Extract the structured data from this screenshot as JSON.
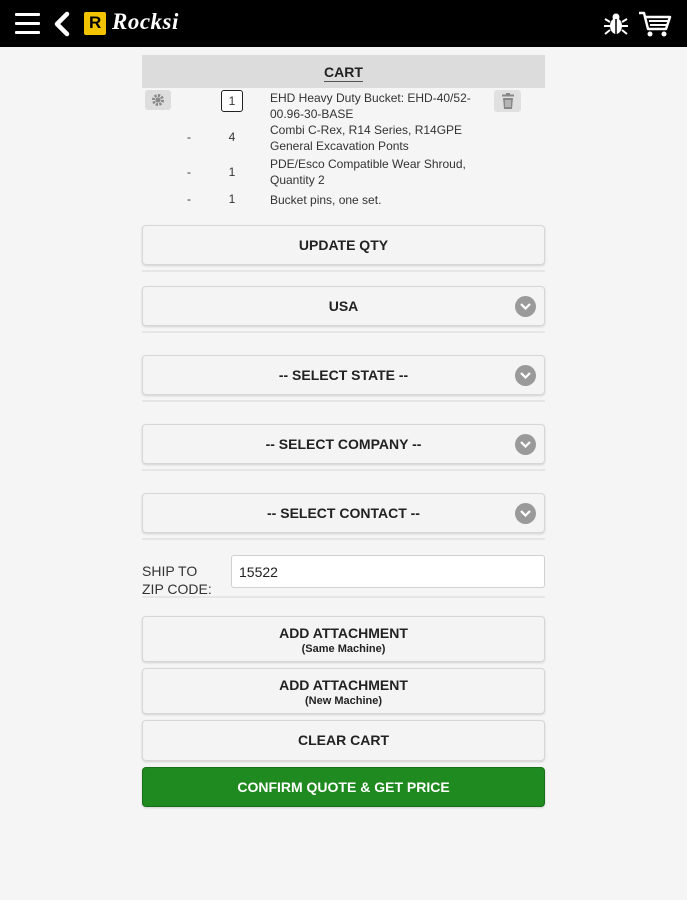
{
  "app": {
    "logo_letter": "R",
    "logo_text": "Rocksi",
    "brand_color": "#f2c300"
  },
  "cart": {
    "title": "CART",
    "items": [
      {
        "qty": "1",
        "desc": "EHD Heavy Duty Bucket: EHD-40/52-00.96-30-BASE"
      },
      {
        "dash": "-",
        "qty": "4",
        "desc": "Combi C-Rex, R14 Series, R14GPE General Excavation Ponts"
      },
      {
        "dash": "-",
        "qty": "1",
        "desc": "PDE/Esco Compatible Wear Shroud, Quantity 2"
      },
      {
        "dash": "-",
        "qty": "1",
        "desc": "Bucket pins, one set."
      }
    ]
  },
  "buttons": {
    "update_qty": "UPDATE QTY",
    "add_attachment_same": "ADD ATTACHMENT",
    "add_attachment_same_sub": "(Same Machine)",
    "add_attachment_new": "ADD ATTACHMENT",
    "add_attachment_new_sub": "(New Machine)",
    "clear_cart": "CLEAR CART",
    "confirm": "CONFIRM QUOTE & GET PRICE"
  },
  "selects": {
    "country": "USA",
    "state": "-- SELECT STATE --",
    "company": "-- SELECT COMPANY --",
    "contact": "-- SELECT CONTACT --"
  },
  "zip": {
    "label_line1": "SHIP TO",
    "label_line2": "ZIP CODE:",
    "value": "15522"
  },
  "colors": {
    "confirm_green": "#1f8a1f",
    "topbar": "#000000"
  }
}
